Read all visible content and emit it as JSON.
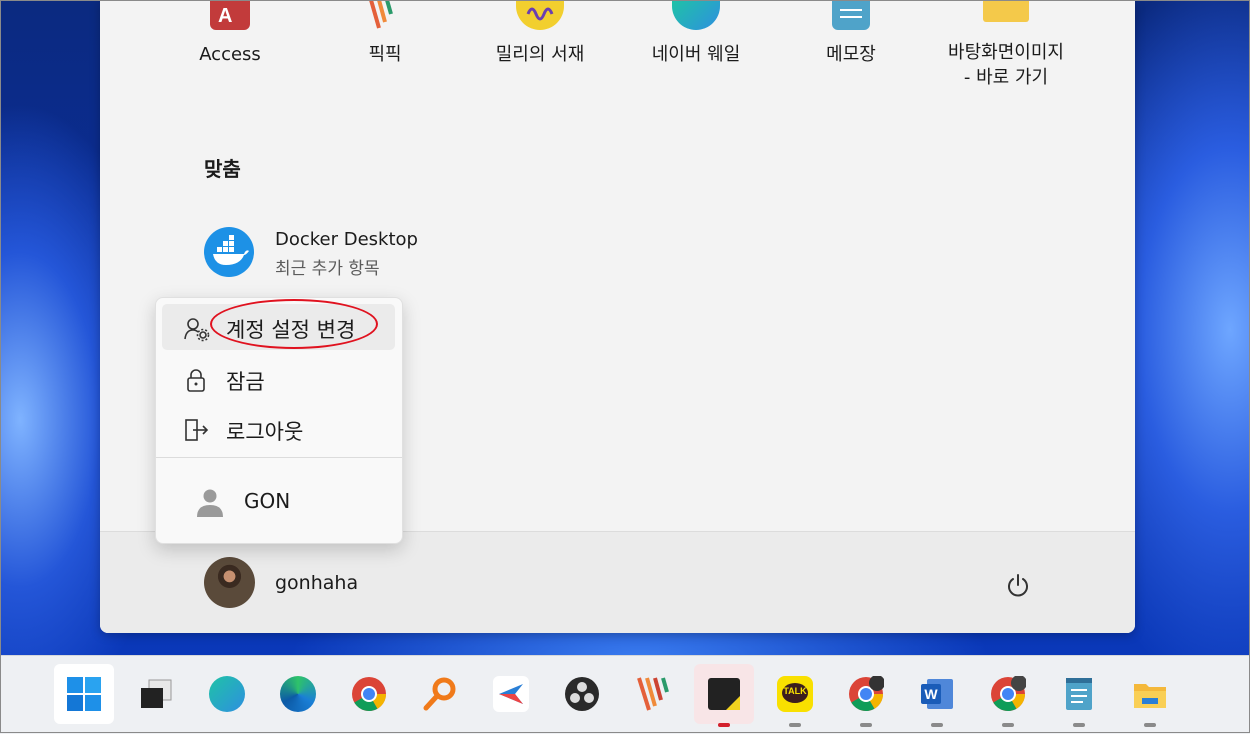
{
  "start_menu": {
    "pinned_apps": [
      {
        "label": "Access",
        "icon": "access-icon",
        "color": "#c23b3b"
      },
      {
        "label": "픽픽",
        "icon": "picpick-icon",
        "color": "#e4603a"
      },
      {
        "label": "밀리의 서재",
        "icon": "millie-icon",
        "color": "#f2cf2e"
      },
      {
        "label": "네이버 웨일",
        "icon": "whale-icon",
        "color": "#2fb7b7"
      },
      {
        "label": "메모장",
        "icon": "notepad-icon",
        "color": "#4fa3c9"
      },
      {
        "label": "바탕화면이미지\n- 바로 가기",
        "icon": "folder-icon",
        "color": "#f4c94a"
      }
    ],
    "recommended": {
      "title": "맞춤",
      "items": [
        {
          "name": "Docker Desktop",
          "subtitle": "최근 추가 항목",
          "icon": "docker-icon"
        }
      ]
    },
    "user": {
      "name": "gonhaha",
      "avatar": "user-avatar"
    },
    "power_icon": "power-icon"
  },
  "account_menu": {
    "items": [
      {
        "label": "계정 설정 변경",
        "icon": "account-settings-icon",
        "highlighted": true
      },
      {
        "label": "잠금",
        "icon": "lock-icon"
      },
      {
        "label": "로그아웃",
        "icon": "sign-out-icon"
      }
    ],
    "other_user": {
      "name": "GON",
      "icon": "person-icon"
    }
  },
  "annotation": {
    "color": "#e0121f"
  },
  "taskbar": {
    "items": [
      {
        "icon": "windows-start-icon",
        "running": false
      },
      {
        "icon": "task-view-icon",
        "running": false
      },
      {
        "icon": "naver-whale-icon",
        "running": false
      },
      {
        "icon": "edge-icon",
        "running": false
      },
      {
        "icon": "chrome-icon",
        "running": false
      },
      {
        "icon": "search-tool-icon",
        "running": false
      },
      {
        "icon": "sourcetree-icon",
        "running": false
      },
      {
        "icon": "obs-icon",
        "running": false
      },
      {
        "icon": "picpick-icon",
        "running": false
      },
      {
        "icon": "sticky-notes-icon",
        "running": true,
        "active": true
      },
      {
        "icon": "kakaotalk-icon",
        "running": true
      },
      {
        "icon": "chrome-profile-icon",
        "running": true
      },
      {
        "icon": "word-icon",
        "running": true
      },
      {
        "icon": "chrome-profile-2-icon",
        "running": true
      },
      {
        "icon": "notepad-icon",
        "running": true
      },
      {
        "icon": "file-explorer-icon",
        "running": true
      }
    ],
    "kakao_label": "TALK",
    "word_label": "W"
  }
}
